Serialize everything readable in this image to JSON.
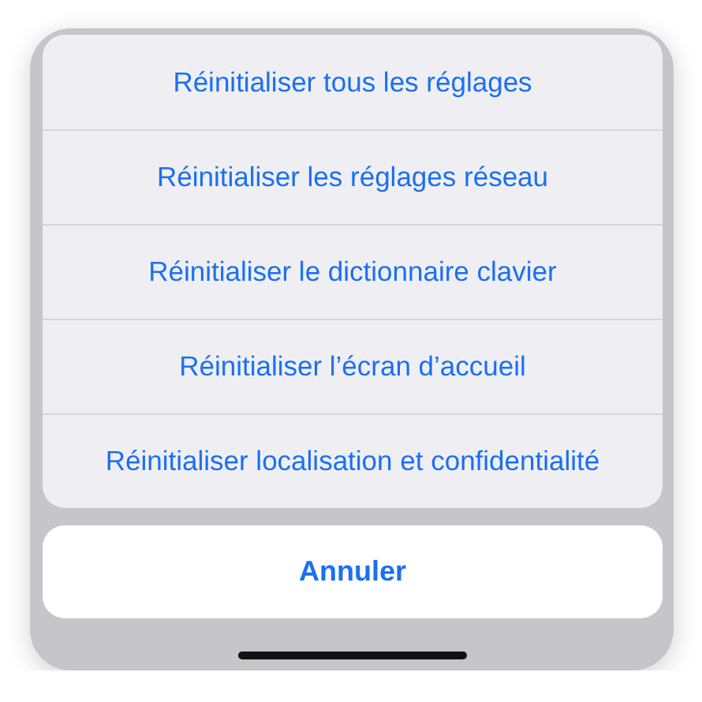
{
  "action_sheet": {
    "actions": [
      {
        "label": "Réinitialiser tous les réglages"
      },
      {
        "label": "Réinitialiser les réglages réseau"
      },
      {
        "label": "Réinitialiser le dictionnaire clavier"
      },
      {
        "label": "Réinitialiser l’écran d’accueil"
      },
      {
        "label": "Réinitialiser localisation et confidentialité"
      }
    ]
  },
  "cancel_button": {
    "label": "Annuler"
  }
}
